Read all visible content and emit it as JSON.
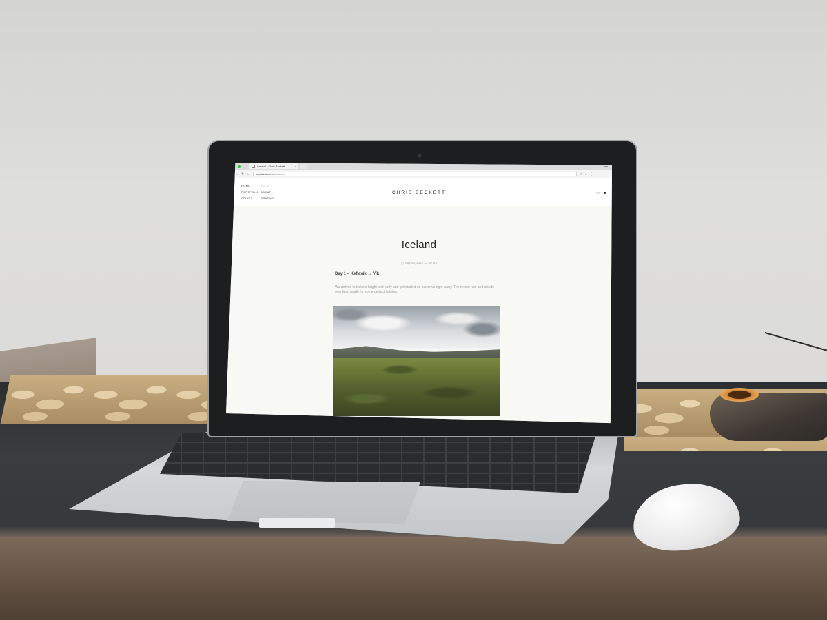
{
  "browser": {
    "tab_title": "Iceland - Chris Beckett",
    "tab_close": "×",
    "profile_name": "Jow",
    "url_host": "chrisbeckett.co",
    "url_path": "/iceland",
    "traffic_light_colors": [
      "#ff5f57",
      "#febc2e",
      "#28c840"
    ]
  },
  "site": {
    "title": "CHRIS BECKETT",
    "nav_left": [
      "HOME",
      "PORTFOLIO",
      "PRINTS"
    ],
    "nav_right": [
      "BLOG",
      "ABOUT",
      "CONTACT"
    ],
    "social_icons": [
      "instagram-icon",
      "facebook-icon"
    ]
  },
  "post": {
    "title": "Iceland",
    "date": "May 05, 2017 11:30 pm",
    "subheading": "Day 1 – Keflavík → Vík",
    "body": "We arrived in Iceland bright and early and got started on our drive right away. The recent rain and clouds overhead made for some perfect lighting."
  }
}
